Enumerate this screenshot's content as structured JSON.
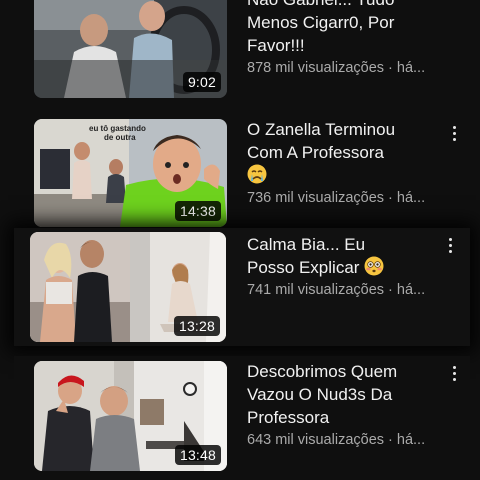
{
  "videos": [
    {
      "title_lines": [
        "Não Gabriel... Tudo",
        "Menos Cigarr0, Por",
        "Favor!!!"
      ],
      "duration": "9:02",
      "meta": "878 mil visualizações · há..."
    },
    {
      "title_lines": [
        "O Zanella Terminou",
        "Com A Professora"
      ],
      "title_emoji": "crying-face-emoji",
      "duration": "14:38",
      "meta": "736 mil visualizações · há...",
      "thumb_caption": "eu tô gastando de outra"
    },
    {
      "title_lines": [
        "Calma Bia... Eu",
        "Posso Explicar"
      ],
      "title_emoji": "flushed-face-emoji",
      "duration": "13:28",
      "meta": "741 mil visualizações · há..."
    },
    {
      "title_lines": [
        "Descobrimos Quem",
        "Vazou O Nud3s Da",
        "Professora"
      ],
      "duration": "13:48",
      "meta": "643 mil visualizações · há..."
    }
  ],
  "colors": {
    "background": "#0f0f0f",
    "title": "#f1f1f1",
    "meta": "#aaaaaa",
    "duration_badge": "#000000"
  }
}
